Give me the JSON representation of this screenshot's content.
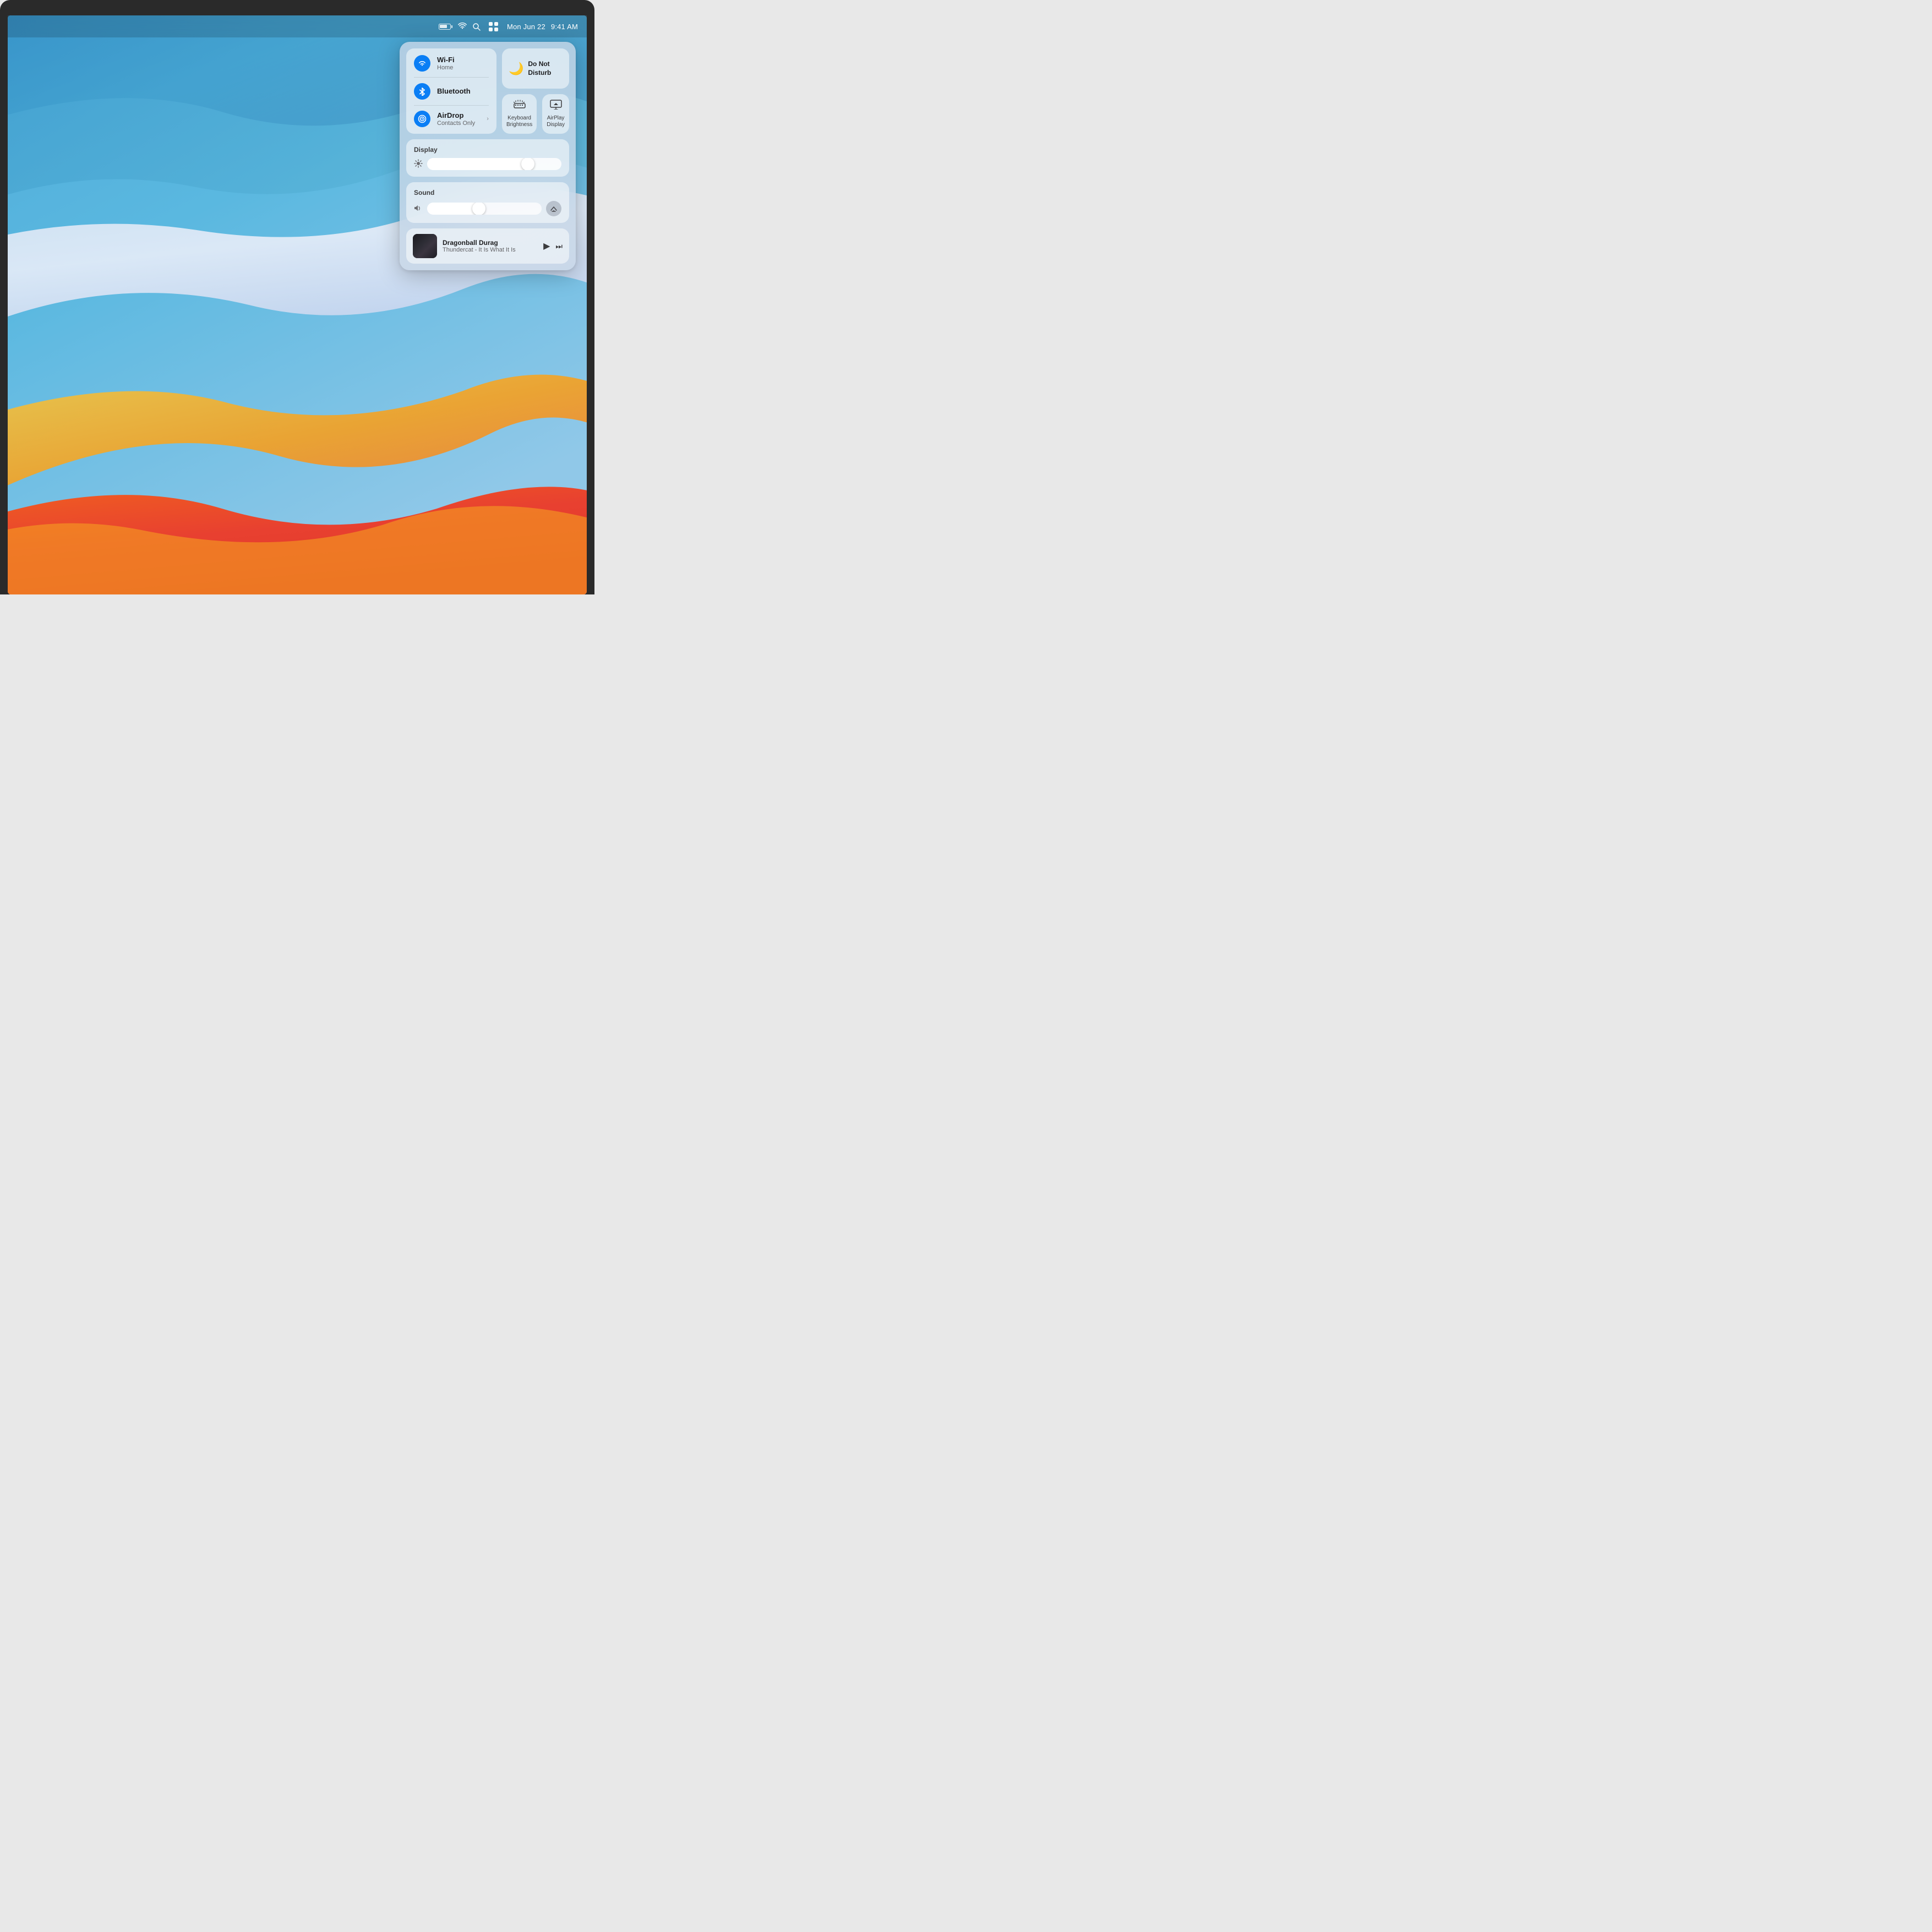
{
  "menubar": {
    "date": "Mon Jun 22",
    "time": "9:41 AM"
  },
  "control_center": {
    "wifi": {
      "name": "Wi-Fi",
      "sub": "Home"
    },
    "bluetooth": {
      "name": "Bluetooth"
    },
    "airdrop": {
      "name": "AirDrop",
      "sub": "Contacts Only"
    },
    "dnd": {
      "label": "Do Not Disturb"
    },
    "keyboard_brightness": {
      "label": "Keyboard Brightness"
    },
    "airplay_display": {
      "label": "AirPlay Display"
    },
    "display": {
      "label": "Display",
      "brightness": 75
    },
    "sound": {
      "label": "Sound",
      "volume": 45
    },
    "now_playing": {
      "track": "Dragonball Durag",
      "artist": "Thundercat - It Is What It Is"
    }
  }
}
